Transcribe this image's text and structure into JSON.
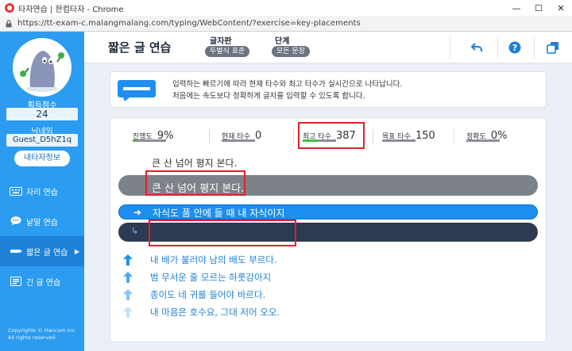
{
  "window": {
    "title": "타자연습 | 한컴타자 - Chrome",
    "url": "https://tt-exam-c.malangmalang.com/typing/WebContent/?exercise=key-placements"
  },
  "sidebar": {
    "score_label": "획득점수",
    "score_value": "24",
    "nickname_label": "닉네임",
    "nickname_value": "Guest_D5hZ1q",
    "profile_button": "내타자정보",
    "items": [
      {
        "label": "자리 연습"
      },
      {
        "label": "낱말 연습"
      },
      {
        "label": "짧은 글 연습",
        "active": true
      },
      {
        "label": "긴 글 연습"
      }
    ],
    "copyright_line1": "Copyrights © Hancom Inc.",
    "copyright_line2": "All rights reserved."
  },
  "header": {
    "title": "짧은 글 연습",
    "layout_label": "글자판",
    "layout_value": "두벌식 표준",
    "level_label": "단계",
    "level_value": "모든 문장"
  },
  "info": {
    "line1": "입력하는 빠르기에 따라 현재 타수와 최고 타수가 실시간으로 나타납니다.",
    "line2": "처음에는 속도보다 정확하게 글자를 입력할 수 있도록 합니다."
  },
  "stats": {
    "progress": {
      "label": "진행도",
      "value": "9%",
      "fraction": 0.09
    },
    "current_speed": {
      "label": "현재 타수",
      "value": "0",
      "fraction": 0
    },
    "max_speed": {
      "label": "최고 타수",
      "value": "387",
      "fraction": 0.45
    },
    "target_speed": {
      "label": "목표 타수",
      "value": "150",
      "fraction": 0
    },
    "accuracy": {
      "label": "정확도",
      "value": "0%",
      "fraction": 0
    }
  },
  "practice": {
    "previous_sentence": "큰 산 넘어 평지 본다.",
    "typed_sentence": "큰 산 넘어 평지 본다.",
    "current_sentence": "자식도 품 안에 들 때 내 자식이지",
    "input_value": "",
    "upcoming": [
      "내 배가 불러야 남의 배도 부르다.",
      "범 무서운 줄 모르는 하룻강아지",
      "종이도 네 귀를 들어야 바르다.",
      "내 마음은 호수요, 그대 저어 오오."
    ]
  },
  "colors": {
    "sidebar": "#2b9cf0",
    "highlight": "#e0202a",
    "current_bar": "#1e8ef0",
    "input_bar": "#2d3b52",
    "upcoming_text": "#1e7fd6"
  },
  "icons": {
    "back": "back-arrow-icon",
    "help": "help-icon",
    "window": "popup-window-icon"
  }
}
